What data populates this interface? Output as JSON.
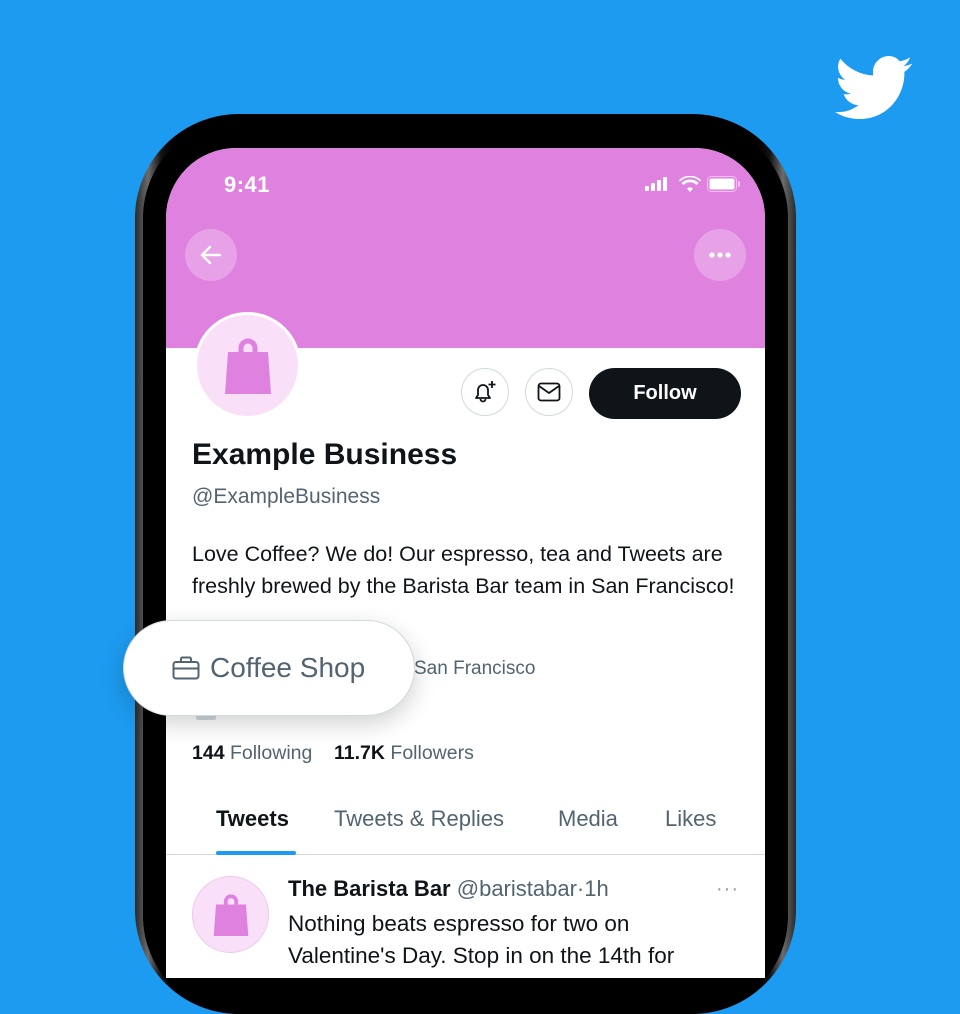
{
  "brand": {
    "logo": "twitter-bird-icon",
    "background": "#1d9bf0",
    "header_color": "#df82df"
  },
  "status_bar": {
    "time": "9:41",
    "icons": [
      "signal-icon",
      "wifi-icon",
      "battery-icon"
    ]
  },
  "nav": {
    "back_icon": "arrow-left-icon",
    "more_icon": "more-horizontal-icon"
  },
  "profile": {
    "name": "Example Business",
    "handle": "@ExampleBusiness",
    "bio": "Love Coffee? We do! Our espresso, tea and Tweets are freshly brewed by the Barista Bar team in San Francisco!",
    "category": "Coffee Shop",
    "location": "San Francisco",
    "following_count": "144",
    "following_label": "Following",
    "followers_count": "11.7K",
    "followers_label": "Followers"
  },
  "actions": {
    "follow_label": "Follow",
    "notify_icon": "bell-plus-icon",
    "message_icon": "mail-icon"
  },
  "tabs": [
    {
      "label": "Tweets",
      "active": true
    },
    {
      "label": "Tweets & Replies",
      "active": false
    },
    {
      "label": "Media",
      "active": false
    },
    {
      "label": "Likes",
      "active": false
    }
  ],
  "tweet": {
    "author": "The Barista Bar",
    "handle": "@baristabar",
    "separator": "·",
    "time": "1h",
    "more": "···",
    "text": "Nothing beats espresso for two on Valentine's Day. Stop in on the 14th for"
  }
}
